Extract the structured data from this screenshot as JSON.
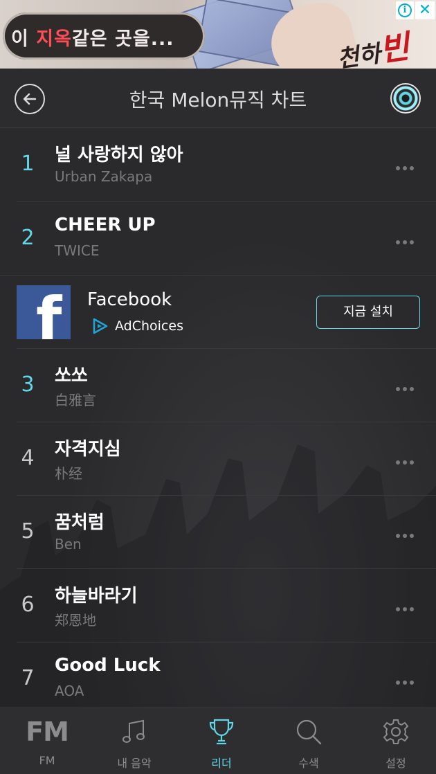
{
  "ad_banner": {
    "text_prefix": "이 ",
    "text_red": "지옥",
    "text_suffix": "같은 곳을...",
    "logo_small": "천하",
    "logo_big": "빈",
    "info_icon": "i",
    "close_icon": "✕"
  },
  "header": {
    "title": "한국 Melon뮤직 차트",
    "back_icon": "back-arrow-icon",
    "disc_icon": "disc-icon"
  },
  "chart": [
    {
      "rank": "1",
      "title": "널 사랑하지 않아",
      "artist": "Urban Zakapa"
    },
    {
      "rank": "2",
      "title": "CHEER UP",
      "artist": "TWICE"
    },
    {
      "rank": "3",
      "title": "쏘쏘",
      "artist": "白雅言"
    },
    {
      "rank": "4",
      "title": "자격지심",
      "artist": "朴经"
    },
    {
      "rank": "5",
      "title": "꿈처럼",
      "artist": "Ben"
    },
    {
      "rank": "6",
      "title": "하늘바라기",
      "artist": "郑恩地"
    },
    {
      "rank": "7",
      "title": "Good Luck",
      "artist": "AOA"
    }
  ],
  "native_ad": {
    "name": "Facebook",
    "logo_letter": "f",
    "adchoices": "AdChoices",
    "install_label": "지금 설치"
  },
  "tabs": [
    {
      "icon": "fm-icon",
      "glyph": "FM",
      "label": "FM"
    },
    {
      "icon": "music-note-icon",
      "label": "내 음악"
    },
    {
      "icon": "trophy-icon",
      "label": "리더"
    },
    {
      "icon": "search-icon",
      "label": "수색"
    },
    {
      "icon": "gear-icon",
      "label": "설정"
    }
  ],
  "colors": {
    "background": "#2a2a2c",
    "accent": "#61d6e6",
    "muted": "#7a7a7c"
  }
}
